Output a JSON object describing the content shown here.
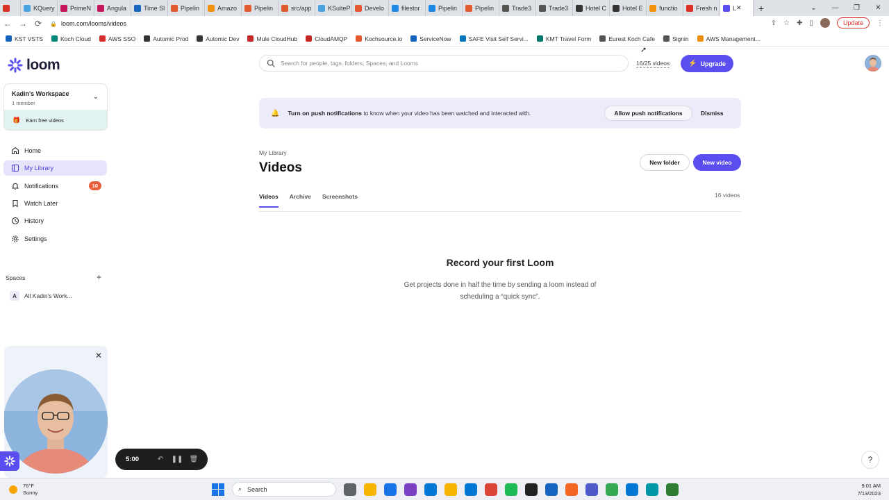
{
  "browser": {
    "tabs": [
      {
        "label": "",
        "color": "#d93025"
      },
      {
        "label": "KQuery",
        "color": "#4aa3df"
      },
      {
        "label": "PrimeN",
        "color": "#c2185b"
      },
      {
        "label": "Angula",
        "color": "#c2185b"
      },
      {
        "label": "Time Sl",
        "color": "#1565c0"
      },
      {
        "label": "Pipelin",
        "color": "#e2592c"
      },
      {
        "label": "Amazo",
        "color": "#f29111"
      },
      {
        "label": "Pipelin",
        "color": "#e2592c"
      },
      {
        "label": "src/app",
        "color": "#e2592c"
      },
      {
        "label": "KSuiteP",
        "color": "#4aa3df"
      },
      {
        "label": "Develo",
        "color": "#e2592c"
      },
      {
        "label": "filestor",
        "color": "#1e88e5"
      },
      {
        "label": "Pipelin",
        "color": "#1e88e5"
      },
      {
        "label": "Pipelin",
        "color": "#e2592c"
      },
      {
        "label": "Trade3",
        "color": "#555555"
      },
      {
        "label": "Trade3",
        "color": "#555555"
      },
      {
        "label": "Hotel C",
        "color": "#333333"
      },
      {
        "label": "Hotel E",
        "color": "#333333"
      },
      {
        "label": "functio",
        "color": "#f29111"
      },
      {
        "label": "Fresh n",
        "color": "#d93025"
      }
    ],
    "active_tab": {
      "label": "L",
      "color": "#5b4ef0"
    },
    "new_tab": "+",
    "url": "loom.com/looms/videos",
    "update_label": "Update",
    "bookmarks": [
      {
        "label": "KST VSTS",
        "color": "#1565c0"
      },
      {
        "label": "Koch Cloud",
        "color": "#00897b"
      },
      {
        "label": "AWS SSO",
        "color": "#d32f2f"
      },
      {
        "label": "Automic Prod",
        "color": "#333333"
      },
      {
        "label": "Automic Dev",
        "color": "#333333"
      },
      {
        "label": "Mule CloudHub",
        "color": "#c62828"
      },
      {
        "label": "CloudAMQP",
        "color": "#c62828"
      },
      {
        "label": "Kochsource.io",
        "color": "#e2592c"
      },
      {
        "label": "ServiceNow",
        "color": "#1565c0"
      },
      {
        "label": "SAFE Visit Self Servi...",
        "color": "#0277bd"
      },
      {
        "label": "KMT Travel Form",
        "color": "#00796b"
      },
      {
        "label": "Eurest Koch Cafe",
        "color": "#555555"
      },
      {
        "label": "Signin",
        "color": "#555555"
      },
      {
        "label": "AWS Management...",
        "color": "#f29111"
      }
    ]
  },
  "brand": {
    "name": "loom",
    "accent": "#5b4ef0"
  },
  "workspace": {
    "name": "Kadin's Workspace",
    "members": "1 member",
    "earn": "Earn free videos"
  },
  "nav": {
    "items": [
      {
        "label": "Home",
        "icon": "home-icon"
      },
      {
        "label": "My Library",
        "icon": "library-icon"
      },
      {
        "label": "Notifications",
        "icon": "bell-icon",
        "badge": "10"
      },
      {
        "label": "Watch Later",
        "icon": "bookmark-icon"
      },
      {
        "label": "History",
        "icon": "clock-icon"
      },
      {
        "label": "Settings",
        "icon": "gear-icon"
      }
    ]
  },
  "spaces": {
    "header": "Spaces",
    "items": [
      {
        "initial": "A",
        "label": "All Kadin's Work..."
      }
    ]
  },
  "recorder": {
    "time": "5:00"
  },
  "header": {
    "search_placeholder": "Search for people, tags, folders, Spaces, and Looms",
    "video_count": "16/25 videos",
    "upgrade_label": "Upgrade"
  },
  "banner": {
    "bold": "Turn on push notifications",
    "text": " to know when your video has been watched and interacted with.",
    "allow_label": "Allow push notifications",
    "dismiss_label": "Dismiss"
  },
  "library": {
    "breadcrumb": "My Library",
    "title": "Videos",
    "new_folder_label": "New folder",
    "new_video_label": "New video",
    "tabs": [
      "Videos",
      "Archive",
      "Screenshots"
    ],
    "total": "16 videos",
    "empty_title": "Record your first Loom",
    "empty_sub": "Get projects done in half the time by sending a loom instead of scheduling a “quick sync”."
  },
  "help_label": "?",
  "taskbar": {
    "temp": "76°F",
    "condition": "Sunny",
    "search_label": "Search",
    "time": "9:01 AM",
    "date": "7/13/2023",
    "app_colors": [
      "#5f6368",
      "#f6b400",
      "#1a73e8",
      "#7b3fc4",
      "#0078d4",
      "#f6b400",
      "#0078d4",
      "#db4437",
      "#1db954",
      "#222222",
      "#1565c0",
      "#f26522",
      "#5059c9",
      "#34a853",
      "#0078d4",
      "#0097a7",
      "#2e7d32"
    ]
  }
}
